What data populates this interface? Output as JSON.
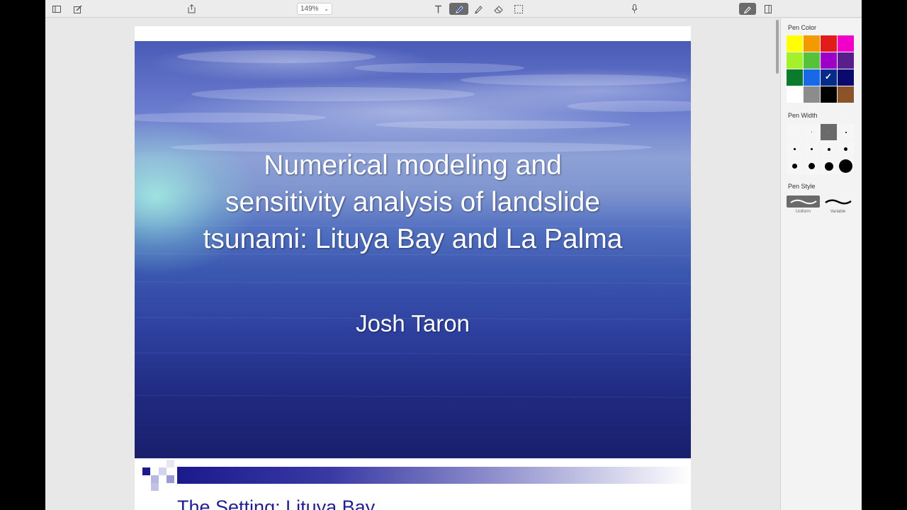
{
  "toolbar": {
    "zoom_value": "149%",
    "icons": [
      "sidebar-icon",
      "compose-icon",
      "share-icon",
      "text-tool-icon",
      "pen-tool-icon",
      "highlighter-icon",
      "eraser-icon",
      "selection-icon",
      "microphone-icon",
      "markup-icon",
      "inspector-icon"
    ]
  },
  "slide": {
    "title_line1": "Numerical modeling and",
    "title_line2": "sensitivity analysis of landslide",
    "title_line3": "tsunami: Lituya Bay and La Palma",
    "author": "Josh Taron"
  },
  "next_slide": {
    "title": "The Setting: Lituya Bay"
  },
  "inspector": {
    "pen_color_label": "Pen Color",
    "pen_width_label": "Pen Width",
    "pen_style_label": "Pen Style",
    "style_uniform": "Uniform",
    "style_variable": "Variable",
    "colors": [
      "#ffff00",
      "#f39a00",
      "#e21b1b",
      "#f000c8",
      "#a4f02a",
      "#56c23c",
      "#9f00c8",
      "#5a1e8c",
      "#0a7a2d",
      "#1868e8",
      "#062c8a",
      "#0a0a6e",
      "#ffffff",
      "#8c8c8c",
      "#000000",
      "#8a5428"
    ],
    "selected_color_index": 10,
    "selected_width_index": 2
  }
}
